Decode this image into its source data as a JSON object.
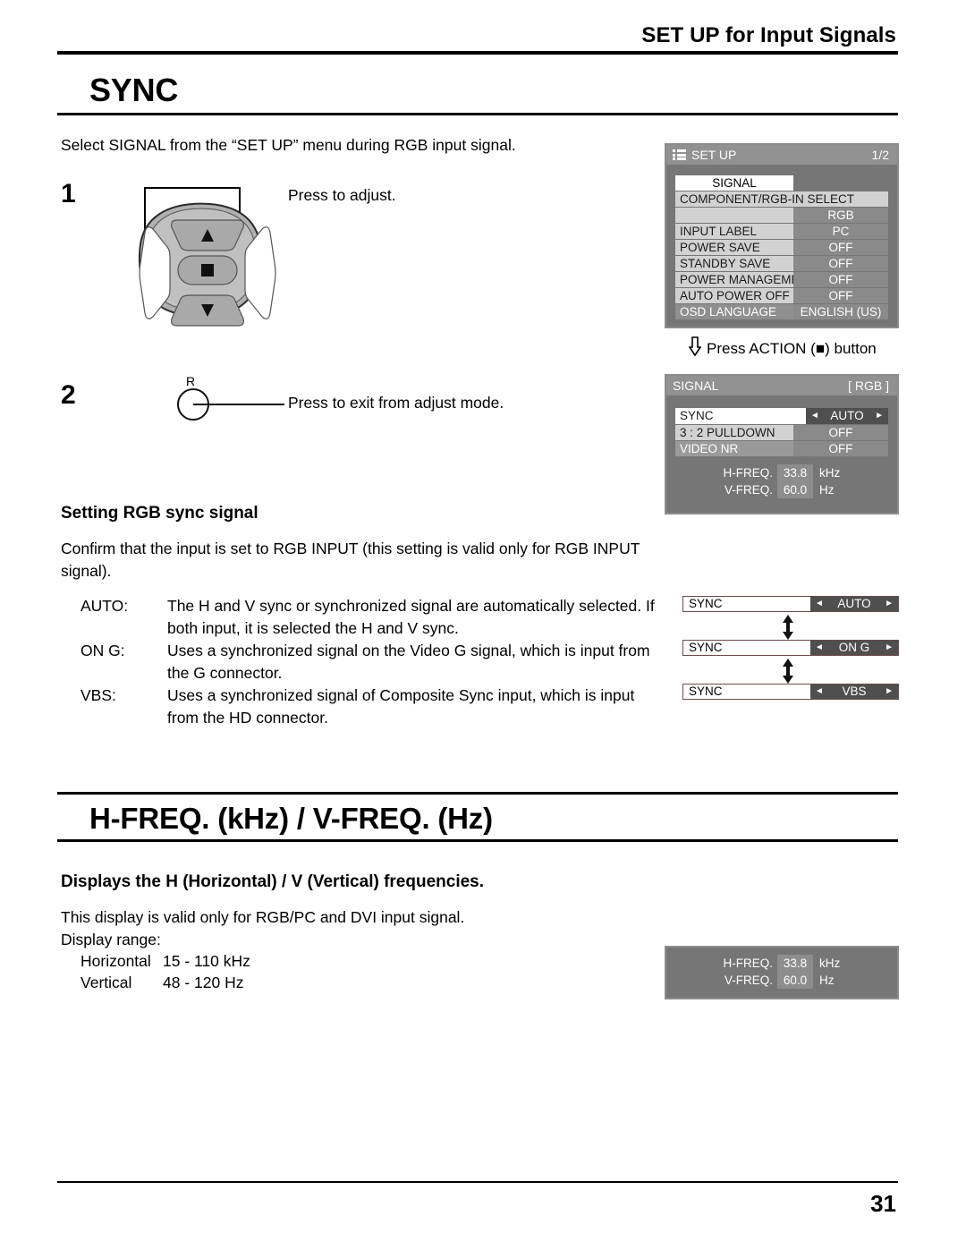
{
  "header": {
    "title": "SET UP for Input Signals"
  },
  "sections": {
    "sync": {
      "title": "SYNC",
      "intro": "Select SIGNAL from the “SET UP” menu during RGB input signal.",
      "steps": [
        {
          "number": "1",
          "callout": "Press to adjust."
        },
        {
          "number": "2",
          "callout": "Press to exit from adjust mode.",
          "button_label": "R"
        }
      ],
      "subhead": "Setting RGB sync signal",
      "confirm": "Confirm that the input is set to RGB INPUT (this setting is valid only for RGB INPUT signal).",
      "definitions": [
        {
          "term": "AUTO:",
          "desc": "The H and V sync or synchronized signal are automatically selected. If both input, it is selected the H and V sync."
        },
        {
          "term": "ON G:",
          "desc": "Uses a synchronized signal on the Video G signal, which is input from the G connector."
        },
        {
          "term": "VBS:",
          "desc": "Uses a synchronized signal of Composite Sync input, which is input from the HD connector."
        }
      ]
    },
    "freq": {
      "title": "H-FREQ. (kHz) / V-FREQ. (Hz)",
      "subhead": "Displays the H (Horizontal) / V (Vertical) frequencies.",
      "body_line1": "This display is valid only for RGB/PC and DVI input signal.",
      "body_line2": "Display range:",
      "ranges": [
        {
          "key": "Horizontal",
          "value": "15 - 110 kHz"
        },
        {
          "key": "Vertical",
          "value": "48 - 120 Hz"
        }
      ]
    }
  },
  "osd": {
    "setup_menu": {
      "icon": "list-icon",
      "title": "SET UP",
      "page": "1/2",
      "rows": [
        {
          "label": "SIGNAL",
          "value": "",
          "style": "highlight"
        },
        {
          "label": "COMPONENT/RGB-IN SELECT",
          "value": "",
          "style": "wide"
        },
        {
          "label": "",
          "value": "RGB",
          "style": "valueonly"
        },
        {
          "label": "INPUT LABEL",
          "value": "PC",
          "style": "normal"
        },
        {
          "label": "POWER SAVE",
          "value": "OFF",
          "style": "normal"
        },
        {
          "label": "STANDBY SAVE",
          "value": "OFF",
          "style": "normal"
        },
        {
          "label": "POWER MANAGEMENT",
          "value": "OFF",
          "style": "normal"
        },
        {
          "label": "AUTO POWER OFF",
          "value": "OFF",
          "style": "normal"
        },
        {
          "label": "OSD LANGUAGE",
          "value": "ENGLISH (US)",
          "style": "normal"
        }
      ]
    },
    "action_note": "Press ACTION (■) button",
    "signal_menu": {
      "title": "SIGNAL",
      "badge": "[ RGB ]",
      "rows": [
        {
          "label": "SYNC",
          "value": "AUTO",
          "style": "selected"
        },
        {
          "label": "3 : 2 PULLDOWN",
          "value": "OFF",
          "style": "normal"
        },
        {
          "label": "VIDEO NR",
          "value": "OFF",
          "style": "normal"
        }
      ],
      "freq": [
        {
          "name": "H-FREQ.",
          "value": "33.8",
          "unit": "kHz"
        },
        {
          "name": "V-FREQ.",
          "value": "60.0",
          "unit": "Hz"
        }
      ]
    },
    "sync_options": [
      {
        "label": "SYNC",
        "value": "AUTO"
      },
      {
        "label": "SYNC",
        "value": "ON G"
      },
      {
        "label": "SYNC",
        "value": "VBS"
      }
    ],
    "freq_panel": [
      {
        "name": "H-FREQ.",
        "value": "33.8",
        "unit": "kHz"
      },
      {
        "name": "V-FREQ.",
        "value": "60.0",
        "unit": "Hz"
      }
    ],
    "arrow_left": "◄",
    "arrow_right": "►"
  },
  "footer": {
    "page_number": "31"
  }
}
